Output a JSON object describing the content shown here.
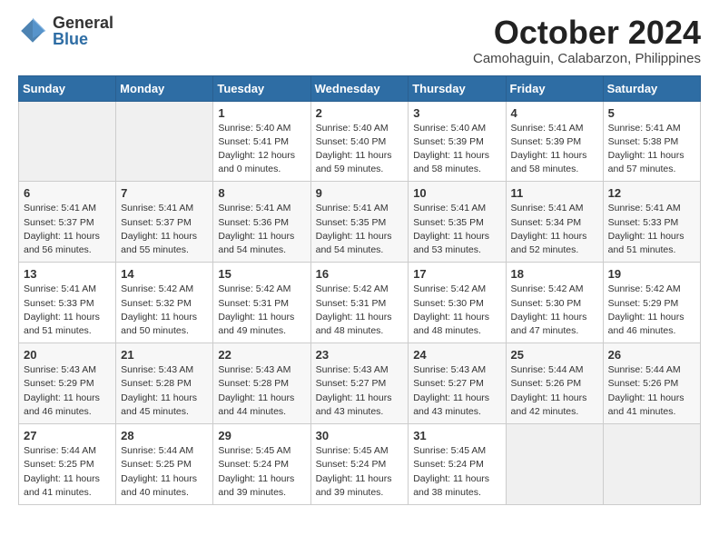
{
  "logo": {
    "general": "General",
    "blue": "Blue"
  },
  "title": "October 2024",
  "location": "Camohaguin, Calabarzon, Philippines",
  "days_header": [
    "Sunday",
    "Monday",
    "Tuesday",
    "Wednesday",
    "Thursday",
    "Friday",
    "Saturday"
  ],
  "weeks": [
    [
      {
        "day": "",
        "info": ""
      },
      {
        "day": "",
        "info": ""
      },
      {
        "day": "1",
        "info": "Sunrise: 5:40 AM\nSunset: 5:41 PM\nDaylight: 12 hours\nand 0 minutes."
      },
      {
        "day": "2",
        "info": "Sunrise: 5:40 AM\nSunset: 5:40 PM\nDaylight: 11 hours\nand 59 minutes."
      },
      {
        "day": "3",
        "info": "Sunrise: 5:40 AM\nSunset: 5:39 PM\nDaylight: 11 hours\nand 58 minutes."
      },
      {
        "day": "4",
        "info": "Sunrise: 5:41 AM\nSunset: 5:39 PM\nDaylight: 11 hours\nand 58 minutes."
      },
      {
        "day": "5",
        "info": "Sunrise: 5:41 AM\nSunset: 5:38 PM\nDaylight: 11 hours\nand 57 minutes."
      }
    ],
    [
      {
        "day": "6",
        "info": "Sunrise: 5:41 AM\nSunset: 5:37 PM\nDaylight: 11 hours\nand 56 minutes."
      },
      {
        "day": "7",
        "info": "Sunrise: 5:41 AM\nSunset: 5:37 PM\nDaylight: 11 hours\nand 55 minutes."
      },
      {
        "day": "8",
        "info": "Sunrise: 5:41 AM\nSunset: 5:36 PM\nDaylight: 11 hours\nand 54 minutes."
      },
      {
        "day": "9",
        "info": "Sunrise: 5:41 AM\nSunset: 5:35 PM\nDaylight: 11 hours\nand 54 minutes."
      },
      {
        "day": "10",
        "info": "Sunrise: 5:41 AM\nSunset: 5:35 PM\nDaylight: 11 hours\nand 53 minutes."
      },
      {
        "day": "11",
        "info": "Sunrise: 5:41 AM\nSunset: 5:34 PM\nDaylight: 11 hours\nand 52 minutes."
      },
      {
        "day": "12",
        "info": "Sunrise: 5:41 AM\nSunset: 5:33 PM\nDaylight: 11 hours\nand 51 minutes."
      }
    ],
    [
      {
        "day": "13",
        "info": "Sunrise: 5:41 AM\nSunset: 5:33 PM\nDaylight: 11 hours\nand 51 minutes."
      },
      {
        "day": "14",
        "info": "Sunrise: 5:42 AM\nSunset: 5:32 PM\nDaylight: 11 hours\nand 50 minutes."
      },
      {
        "day": "15",
        "info": "Sunrise: 5:42 AM\nSunset: 5:31 PM\nDaylight: 11 hours\nand 49 minutes."
      },
      {
        "day": "16",
        "info": "Sunrise: 5:42 AM\nSunset: 5:31 PM\nDaylight: 11 hours\nand 48 minutes."
      },
      {
        "day": "17",
        "info": "Sunrise: 5:42 AM\nSunset: 5:30 PM\nDaylight: 11 hours\nand 48 minutes."
      },
      {
        "day": "18",
        "info": "Sunrise: 5:42 AM\nSunset: 5:30 PM\nDaylight: 11 hours\nand 47 minutes."
      },
      {
        "day": "19",
        "info": "Sunrise: 5:42 AM\nSunset: 5:29 PM\nDaylight: 11 hours\nand 46 minutes."
      }
    ],
    [
      {
        "day": "20",
        "info": "Sunrise: 5:43 AM\nSunset: 5:29 PM\nDaylight: 11 hours\nand 46 minutes."
      },
      {
        "day": "21",
        "info": "Sunrise: 5:43 AM\nSunset: 5:28 PM\nDaylight: 11 hours\nand 45 minutes."
      },
      {
        "day": "22",
        "info": "Sunrise: 5:43 AM\nSunset: 5:28 PM\nDaylight: 11 hours\nand 44 minutes."
      },
      {
        "day": "23",
        "info": "Sunrise: 5:43 AM\nSunset: 5:27 PM\nDaylight: 11 hours\nand 43 minutes."
      },
      {
        "day": "24",
        "info": "Sunrise: 5:43 AM\nSunset: 5:27 PM\nDaylight: 11 hours\nand 43 minutes."
      },
      {
        "day": "25",
        "info": "Sunrise: 5:44 AM\nSunset: 5:26 PM\nDaylight: 11 hours\nand 42 minutes."
      },
      {
        "day": "26",
        "info": "Sunrise: 5:44 AM\nSunset: 5:26 PM\nDaylight: 11 hours\nand 41 minutes."
      }
    ],
    [
      {
        "day": "27",
        "info": "Sunrise: 5:44 AM\nSunset: 5:25 PM\nDaylight: 11 hours\nand 41 minutes."
      },
      {
        "day": "28",
        "info": "Sunrise: 5:44 AM\nSunset: 5:25 PM\nDaylight: 11 hours\nand 40 minutes."
      },
      {
        "day": "29",
        "info": "Sunrise: 5:45 AM\nSunset: 5:24 PM\nDaylight: 11 hours\nand 39 minutes."
      },
      {
        "day": "30",
        "info": "Sunrise: 5:45 AM\nSunset: 5:24 PM\nDaylight: 11 hours\nand 39 minutes."
      },
      {
        "day": "31",
        "info": "Sunrise: 5:45 AM\nSunset: 5:24 PM\nDaylight: 11 hours\nand 38 minutes."
      },
      {
        "day": "",
        "info": ""
      },
      {
        "day": "",
        "info": ""
      }
    ]
  ]
}
